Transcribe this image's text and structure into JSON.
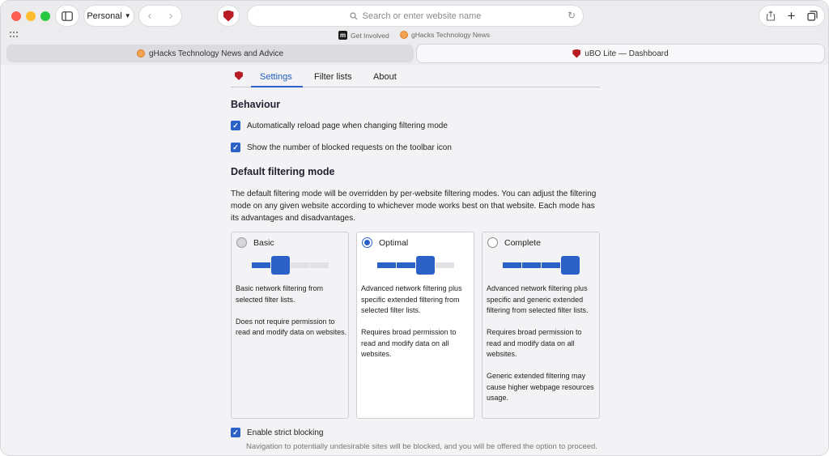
{
  "browser": {
    "profile_label": "Personal",
    "address_placeholder": "Search or enter website name",
    "favorites": [
      {
        "label": "Get Involved",
        "icon": "m-logo-icon"
      },
      {
        "label": "gHacks Technology News",
        "icon": "ghacks-logo-icon"
      }
    ],
    "tabs": [
      {
        "label": "gHacks Technology News and Advice",
        "active": false
      },
      {
        "label": "uBO Lite — Dashboard",
        "active": true
      }
    ]
  },
  "dashboard": {
    "tabs": [
      {
        "label": "Settings",
        "active": true
      },
      {
        "label": "Filter lists",
        "active": false
      },
      {
        "label": "About",
        "active": false
      }
    ],
    "behaviour": {
      "heading": "Behaviour",
      "options": [
        {
          "label": "Automatically reload page when changing filtering mode",
          "checked": true
        },
        {
          "label": "Show the number of blocked requests on the toolbar icon",
          "checked": true
        }
      ]
    },
    "default_mode": {
      "heading": "Default filtering mode",
      "description": "The default filtering mode will be overridden by per-website filtering modes. You can adjust the filtering mode on any given website according to whichever mode works best on that website. Each mode has its advantages and disadvantages.",
      "modes": [
        {
          "name": "Basic",
          "selected": false,
          "level": 1,
          "paragraphs": [
            "Basic network filtering from selected filter lists.",
            "Does not require permission to read and modify data on websites."
          ]
        },
        {
          "name": "Optimal",
          "selected": true,
          "level": 2,
          "paragraphs": [
            "Advanced network filtering plus specific extended filtering from selected filter lists.",
            "Requires broad permission to read and modify data on all websites."
          ]
        },
        {
          "name": "Complete",
          "selected": false,
          "level": 3,
          "paragraphs": [
            "Advanced network filtering plus specific and generic extended filtering from selected filter lists.",
            "Requires broad permission to read and modify data on all websites.",
            "Generic extended filtering may cause higher webpage resources usage."
          ]
        }
      ]
    },
    "strict": {
      "label": "Enable strict blocking",
      "checked": true,
      "note": "Navigation to potentially undesirable sites will be blocked, and you will be offered the option to proceed."
    }
  },
  "colors": {
    "accent": "#2c62c7",
    "ublock_red": "#b81d24"
  }
}
